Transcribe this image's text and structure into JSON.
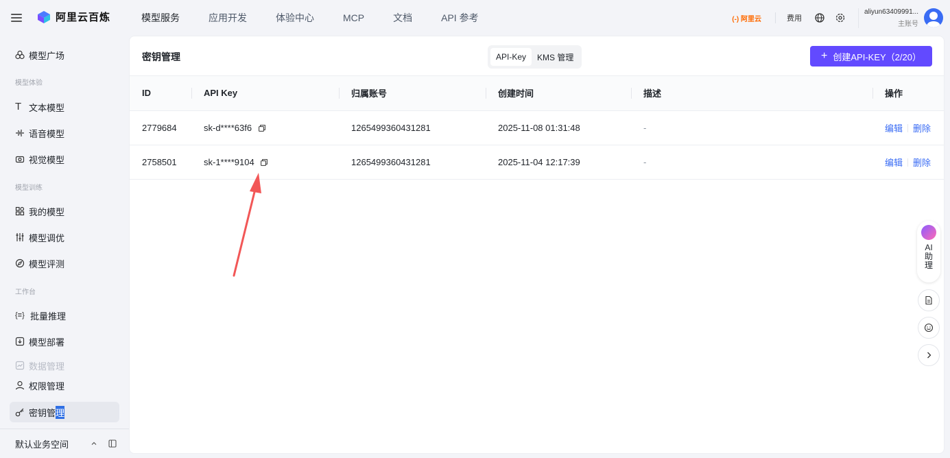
{
  "app": {
    "logo_text": "阿里云百炼"
  },
  "topnav": {
    "items": [
      "模型服务",
      "应用开发",
      "体验中心",
      "MCP",
      "文档",
      "API 参考"
    ]
  },
  "topright": {
    "aliyun_badge": "(-) 阿里云",
    "fee": "费用",
    "user_name": "aliyun63409991...",
    "user_role": "主账号"
  },
  "sidebar": {
    "top_item": "模型广场",
    "sections": [
      "模型体验",
      "模型训练",
      "工作台"
    ],
    "items": [
      "文本模型",
      "语音模型",
      "视觉模型",
      "我的模型",
      "模型调优",
      "模型评测",
      "批量推理",
      "模型部署",
      "数据管理",
      "权限管理"
    ],
    "selected_prefix": "密钥管",
    "selected_highlight": "理",
    "footer_label": "默认业务空间"
  },
  "panel": {
    "title": "密钥管理",
    "tabs": [
      "API-Key",
      "KMS 管理"
    ],
    "create_label": "创建API-KEY（2/20）"
  },
  "table": {
    "headers": [
      "ID",
      "API Key",
      "归属账号",
      "创建时间",
      "描述",
      "操作"
    ],
    "rows": [
      {
        "id": "2779684",
        "key": "sk-d****63f6",
        "account": "1265499360431281",
        "created": "2025-11-08 01:31:48",
        "desc": "-"
      },
      {
        "id": "2758501",
        "key": "sk-1****9104",
        "account": "1265499360431281",
        "created": "2025-11-04 12:17:39",
        "desc": "-"
      }
    ],
    "edit_label": "编辑",
    "delete_label": "删除"
  },
  "assistant": {
    "label": "AI 助理"
  },
  "colors": {
    "accent": "#624aff",
    "link": "#3a6cf4",
    "arrow": "#f25757"
  }
}
